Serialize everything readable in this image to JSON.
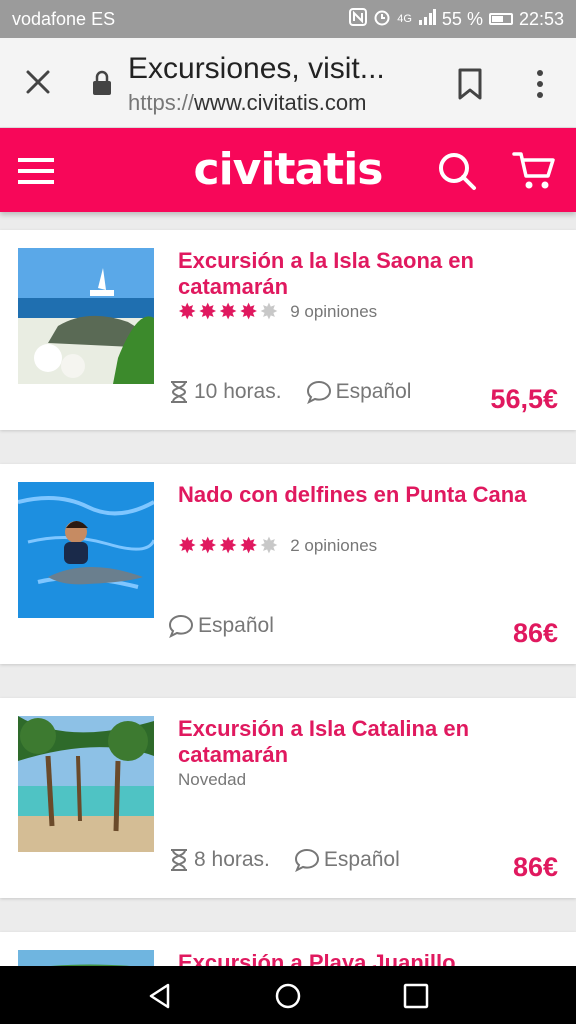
{
  "status_bar": {
    "carrier": "vodafone ES",
    "network": "4G",
    "battery": "55 %",
    "time": "22:53"
  },
  "browser": {
    "page_title": "Excursiones, visit...",
    "url_protocol": "https://",
    "url_host": "www.civitatis.com"
  },
  "header": {
    "logo_text": "civitatis",
    "brand_color": "#f70759"
  },
  "tours": [
    {
      "title": "Excursión a la Isla Saona en catamarán",
      "rating": 4.5,
      "opinions": "9 opiniones",
      "duration": "10 horas.",
      "language": "Español",
      "price": "56,5€"
    },
    {
      "title": "Nado con delfines en Punta Cana",
      "rating": 4.5,
      "opinions": "2 opiniones",
      "language": "Español",
      "price": "86€"
    },
    {
      "title": "Excursión a Isla Catalina en catamarán",
      "badge": "Novedad",
      "duration": "8 horas.",
      "language": "Español",
      "price": "86€"
    },
    {
      "title": "Excursión a Playa Juanillo"
    }
  ]
}
